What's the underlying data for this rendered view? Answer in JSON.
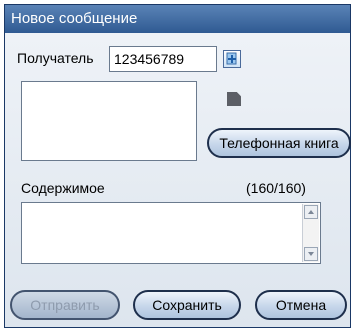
{
  "window": {
    "title": "Новое сообщение"
  },
  "recipient": {
    "label": "Получатель",
    "value": "123456789",
    "add_icon": "add-contact-icon",
    "remove_icon": "remove-recipient-icon"
  },
  "buttons": {
    "phonebook": "Телефонная книга",
    "send": "Отправить",
    "save": "Сохранить",
    "cancel": "Отмена"
  },
  "content": {
    "label": "Содержимое",
    "counter": "(160/160)",
    "value": ""
  },
  "colors": {
    "title_bar": "#3d679f",
    "button_border": "#1e2f4c",
    "disabled_text": "#8e9bad"
  }
}
